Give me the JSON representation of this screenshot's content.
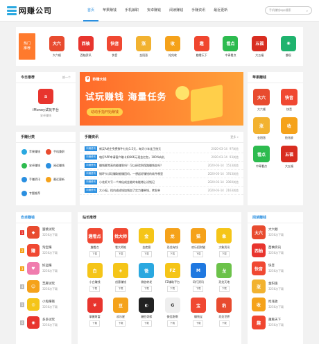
{
  "header": {
    "logo": "网赚公司",
    "nav": [
      "首页",
      "苹果赚钱",
      "手机兼职",
      "安卓赚钱",
      "阅读赚钱",
      "手赚资讯",
      "最近更新"
    ],
    "search": "手机赚钱app搜索"
  },
  "top_ribbon": [
    "热门",
    "推荐"
  ],
  "top_apps": [
    {
      "name": "大六顺",
      "icon": "大六",
      "color": "#e84b2f"
    },
    {
      "name": "西柚资讯",
      "icon": "西柚",
      "color": "#e8352e"
    },
    {
      "name": "快音",
      "icon": "快音",
      "color": "#f04832"
    },
    {
      "name": "金阳涨",
      "icon": "涨",
      "color": "#f2b230"
    },
    {
      "name": "抢兆收",
      "icon": "收",
      "color": "#f5a21a"
    },
    {
      "name": "趣看天下",
      "icon": "趣",
      "color": "#f0462f"
    },
    {
      "name": "中青看点",
      "icon": "看点",
      "color": "#2dbb4f"
    },
    {
      "name": "大五福",
      "icon": "五福",
      "color": "#d82d20"
    },
    {
      "name": "趣现",
      "icon": "◉",
      "color": "#1fb36e"
    }
  ],
  "today": {
    "title": "今日推荐",
    "more": "换一个",
    "app": "iMoney试玩平台",
    "sub": "安卓赚钱",
    "icon": "≋"
  },
  "banner": {
    "brand": "秒赚大钱",
    "h1": "试玩赚钱 海量任务",
    "btn": "动动手指开始赚钱"
  },
  "apple": {
    "title": "苹果赚钱",
    "items": [
      {
        "name": "大六顺",
        "icon": "大六",
        "color": "#e84b2f"
      },
      {
        "name": "快音",
        "icon": "快音",
        "color": "#f04832"
      },
      {
        "name": "金阳涨",
        "icon": "涨",
        "color": "#f2b230"
      },
      {
        "name": "抢兆收",
        "icon": "收",
        "color": "#f5a21a"
      },
      {
        "name": "中青看点",
        "icon": "看点",
        "color": "#2dbb4f"
      },
      {
        "name": "大五福",
        "icon": "五福",
        "color": "#d82d20"
      }
    ]
  },
  "cats": {
    "title": "手赚分类",
    "items": [
      {
        "l": "苹果赚钱",
        "c": "#2aa8e0"
      },
      {
        "l": "手机兼职",
        "c": "#e84b2f"
      },
      {
        "l": "安卓赚钱",
        "c": "#2dbb4f"
      },
      {
        "l": "阅读赚钱",
        "c": "#2a8fe0"
      },
      {
        "l": "手赚资讯",
        "c": "#2a8fe0"
      },
      {
        "l": "最近更新",
        "c": "#f5a21a"
      },
      {
        "l": "专题推荐",
        "c": "#2a8fe0"
      }
    ]
  },
  "news": {
    "title": "手赚资讯",
    "more": "更多 »",
    "tag": "手赚资讯",
    "items": [
      {
        "t": "新买A地主免费鲜牛红包1.5元，每天小年连王统元",
        "d": "2020-03-14",
        "v": "97浏览"
      },
      {
        "t": "咱仔APP申请客户赚卡如666元现金红包，100%有礼",
        "d": "2020-03-14",
        "v": "93浏览"
      },
      {
        "t": "赚钱脚常高的能赚到吗？可以经验到保路赚钱金吗？",
        "d": "2020-03-14",
        "v": "1513浏览"
      },
      {
        "t": "储环卡试玩赚取能赚回吗，一想起好赚钱的软件哪里",
        "d": "2020-03-14",
        "v": "1913浏览"
      },
      {
        "t": "小花虾大亏一个神仙成金能的有能增心试钱记",
        "d": "2020-03-14",
        "v": "2060浏览"
      },
      {
        "t": "大小祖，找内成成钱加钱加了实力赚单钱，转发单",
        "d": "2020-03-14",
        "v": "2163浏览"
      }
    ]
  },
  "android": {
    "title": "安卓赚钱",
    "items": [
      {
        "n": "1",
        "name": "蜜桃试玩",
        "sub": "3256次下载",
        "icon": "◆",
        "color": "#e84b2f",
        "nc": "#e8352e"
      },
      {
        "n": "2",
        "name": "淘宝赚",
        "sub": "3256次下载",
        "icon": "赚",
        "color": "#f04832",
        "nc": "#f5a21a"
      },
      {
        "n": "3",
        "name": "好运赚",
        "sub": "3256次下载",
        "icon": "♥",
        "color": "#f07cae",
        "nc": "#f5a21a"
      },
      {
        "n": "4",
        "name": "芝麻试玩",
        "sub": "3256次下载",
        "icon": "☺",
        "color": "#f5a21a",
        "nc": "#bbb"
      },
      {
        "n": "5",
        "name": "小兔赚钱",
        "sub": "3256次下载",
        "icon": "◎",
        "color": "#f5c518",
        "nc": "#bbb"
      },
      {
        "n": "6",
        "name": "多多试玩",
        "sub": "3256次下载",
        "icon": "◉",
        "color": "#e8352e",
        "nc": "#bbb"
      }
    ]
  },
  "station": {
    "title": "站长推荐",
    "btn": "下载",
    "items": [
      {
        "name": "趣看点",
        "icon": "趣看点",
        "color": "#f04832"
      },
      {
        "name": "看大师推",
        "icon": "找大师",
        "color": "#f04832"
      },
      {
        "name": "金疙瘩",
        "icon": "金",
        "color": "#f5c518"
      },
      {
        "name": "恐龙有钱",
        "icon": "龙",
        "color": "#f5a21a"
      },
      {
        "name": "欢乐招财猫",
        "icon": "猫",
        "color": "#f5a21a"
      },
      {
        "name": "大象资讯",
        "icon": "象",
        "color": "#f5c518"
      },
      {
        "name": "小白赚钱",
        "icon": "白",
        "color": "#f5c518"
      },
      {
        "name": "创意赚钱",
        "icon": "◈",
        "color": "#f5c518"
      },
      {
        "name": "微信转发",
        "icon": "微",
        "color": "#2aa8e0"
      },
      {
        "name": "FZ辅助平台",
        "icon": "FZ",
        "color": "#f5c518"
      },
      {
        "name": "码行资讯",
        "icon": "M",
        "color": "#1f78e0"
      },
      {
        "name": "恐龙天地",
        "icon": "龙",
        "color": "#6cc24a"
      },
      {
        "name": "掌握财富",
        "icon": "¥",
        "color": "#e8352e"
      },
      {
        "name": "欢乐星",
        "icon": "豆",
        "color": "#f5a21a"
      },
      {
        "name": "糖豆奇缘",
        "icon": "◐",
        "color": "#222"
      },
      {
        "name": "微信跑啊",
        "icon": "G",
        "color": "#eee"
      },
      {
        "name": "赚钱宝",
        "icon": "宝",
        "color": "#f04832"
      },
      {
        "name": "恐龙世界",
        "icon": "豹",
        "color": "#e84b2f"
      }
    ]
  },
  "reading": {
    "title": "阅读赚钱",
    "items": [
      {
        "name": "大六顺",
        "sub": "3256次下载",
        "icon": "大六",
        "color": "#e84b2f"
      },
      {
        "name": "西柚资讯",
        "sub": "3256次下载",
        "icon": "西柚",
        "color": "#e8352e"
      },
      {
        "name": "快音",
        "sub": "3256次下载",
        "icon": "快音",
        "color": "#f04832"
      },
      {
        "name": "金阳涨",
        "sub": "3256次下载",
        "icon": "涨",
        "color": "#f2b230"
      },
      {
        "name": "抢兆收",
        "sub": "3256次下载",
        "icon": "收",
        "color": "#f5a21a"
      },
      {
        "name": "趣看天下",
        "sub": "3256次下载",
        "icon": "趣",
        "color": "#f0462f"
      }
    ]
  }
}
